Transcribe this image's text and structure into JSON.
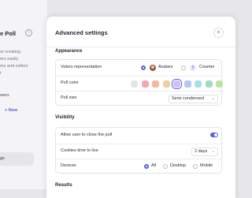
{
  "background": {
    "title": "e Poll",
    "description_lines": [
      "or creating",
      "ers easily",
      "ms and collect",
      "t"
    ],
    "answers_label": "wers",
    "add_new": "+ New",
    "nav_item": "gs"
  },
  "modal": {
    "title": "Advanced settings",
    "close_glyph": "×",
    "appearance": {
      "label": "Appearance",
      "voters_representation": {
        "label": "Voters representation",
        "options": [
          "Avatars",
          "Counter"
        ],
        "selected": "Avatars",
        "counter_badge": "0"
      },
      "poll_color": {
        "label": "Poll color",
        "colors": [
          "#e4e5ea",
          "#f3a7b2",
          "#f5b9a0",
          "#f0ce9e",
          "#d2bdf5",
          "#b3c6f5",
          "#a9dde9",
          "#9fdcc3",
          "#bde3a0"
        ],
        "selected_index": 4
      },
      "poll_size": {
        "label": "Poll size",
        "value": "Semi condensed"
      }
    },
    "visibility": {
      "label": "Visibility",
      "allow_close": {
        "label": "Allow user to close the poll",
        "enabled": true
      },
      "cookies": {
        "label": "Cookies time to live",
        "value": "2 days"
      },
      "devices": {
        "label": "Devices",
        "options": [
          "All",
          "Desktop",
          "Mobile"
        ],
        "selected": "All"
      }
    },
    "results": {
      "label": "Results"
    }
  },
  "colors": {
    "accent": "#5a5fe0"
  }
}
